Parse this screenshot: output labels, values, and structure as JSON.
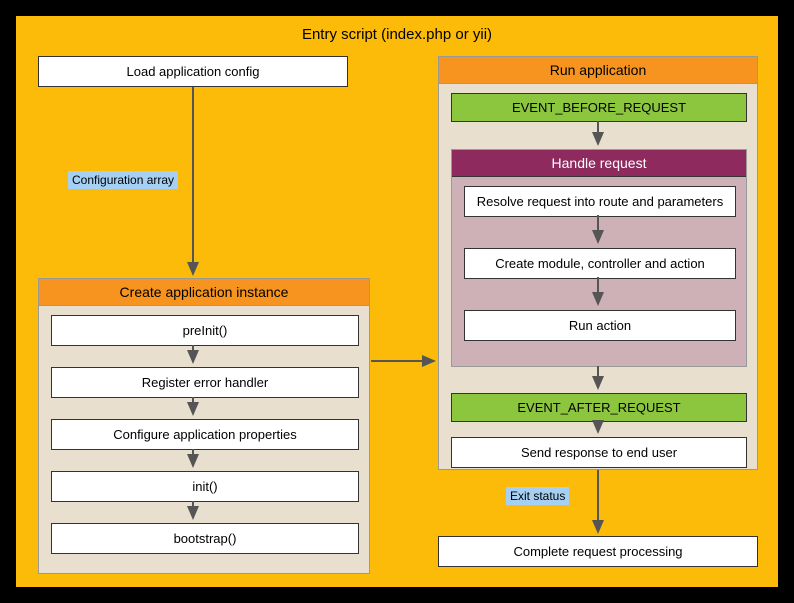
{
  "mainTitle": "Entry script (index.php or yii)",
  "loadConfig": "Load application config",
  "configArrayLabel": "Configuration array",
  "createInstance": {
    "header": "Create application instance",
    "preInit": "preInit()",
    "registerError": "Register error handler",
    "configureProps": "Configure application properties",
    "init": "init()",
    "bootstrap": "bootstrap()"
  },
  "runApp": {
    "header": "Run application",
    "eventBefore": "EVENT_BEFORE_REQUEST",
    "handle": {
      "header": "Handle request",
      "resolve": "Resolve request into route and parameters",
      "createModule": "Create module, controller and action",
      "runAction": "Run action"
    },
    "eventAfter": "EVENT_AFTER_REQUEST",
    "sendResponse": "Send response to end user"
  },
  "exitStatusLabel": "Exit status",
  "completeProcessing": "Complete request processing"
}
